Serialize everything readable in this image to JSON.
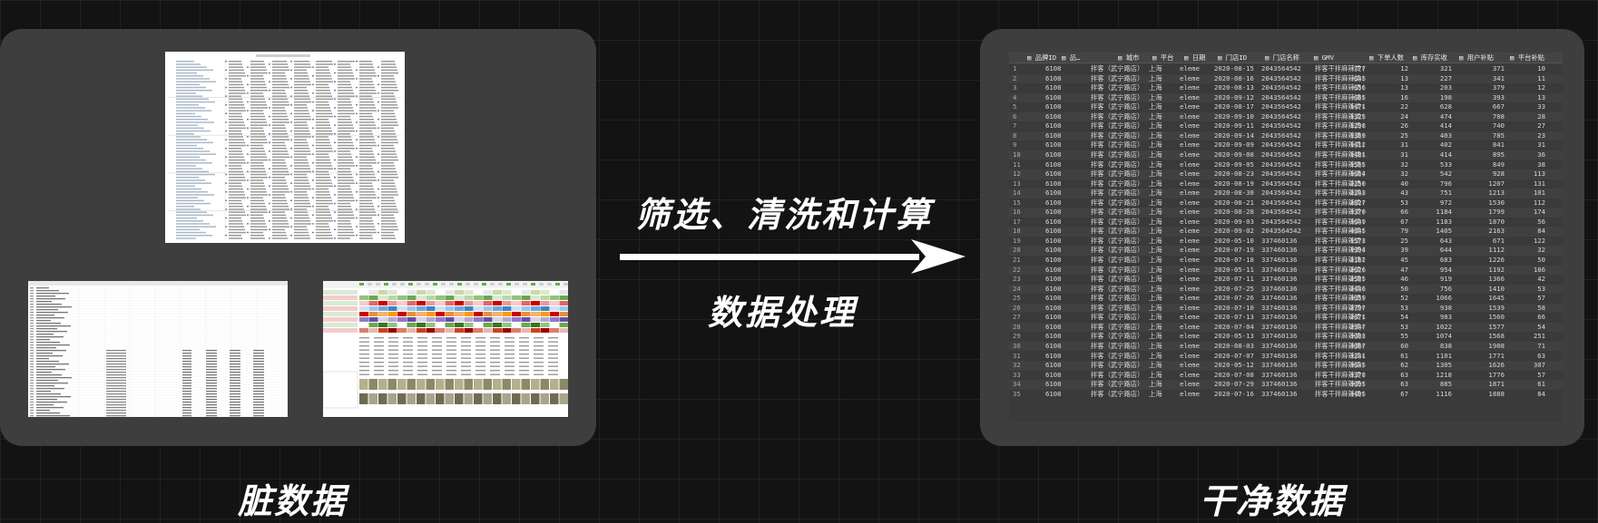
{
  "labels": {
    "dirty": "脏数据",
    "clean": "干净数据",
    "arrow_top": "筛选、清洗和计算",
    "arrow_bottom": "数据处理"
  },
  "clean_table": {
    "headers": [
      "品牌ID",
      "品…",
      "城市",
      "平台",
      "日期",
      "门店ID",
      "门店名称",
      "GMV",
      "下单人数",
      "库存实收",
      "用户补贴",
      "平台补贴"
    ],
    "rows": [
      [
        "1",
        "6108",
        "拌客（武宁路店）",
        "上海",
        "eleme",
        "2020-08-15",
        "2043564542",
        "拌客干拌麻辣烫(",
        "777",
        "12",
        "321",
        "371",
        "10"
      ],
      [
        "2",
        "6108",
        "拌客（武宁路店）",
        "上海",
        "eleme",
        "2020-08-16",
        "2043564542",
        "拌客干拌麻辣烫(",
        "645",
        "13",
        "227",
        "341",
        "11"
      ],
      [
        "3",
        "6108",
        "拌客（武宁路店）",
        "上海",
        "eleme",
        "2020-08-13",
        "2043564542",
        "拌客干拌麻辣烫(",
        "656",
        "13",
        "203",
        "379",
        "12"
      ],
      [
        "4",
        "6108",
        "拌客（武宁路店）",
        "上海",
        "eleme",
        "2020-09-12",
        "2043564542",
        "拌客干拌麻辣烫(",
        "665",
        "16",
        "198",
        "393",
        "13"
      ],
      [
        "5",
        "6108",
        "拌客（武宁路店）",
        "上海",
        "eleme",
        "2020-08-17",
        "2043564542",
        "拌客干拌麻辣烫(",
        "1471",
        "22",
        "628",
        "667",
        "33"
      ],
      [
        "6",
        "6108",
        "拌客（武宁路店）",
        "上海",
        "eleme",
        "2020-09-10",
        "2043564542",
        "拌客干拌麻辣烫(",
        "1325",
        "24",
        "474",
        "708",
        "28"
      ],
      [
        "7",
        "6108",
        "拌客（武宁路店）",
        "上海",
        "eleme",
        "2020-09-11",
        "2043564542",
        "拌客干拌麻辣烫(",
        "1298",
        "26",
        "414",
        "740",
        "27"
      ],
      [
        "8",
        "6108",
        "拌客（武宁路店）",
        "上海",
        "eleme",
        "2020-09-14",
        "2043564542",
        "拌客干拌麻辣烫(",
        "1369",
        "25",
        "403",
        "785",
        "23"
      ],
      [
        "9",
        "6108",
        "拌客（武宁路店）",
        "上海",
        "eleme",
        "2020-09-09",
        "2043564542",
        "拌客干拌麻辣烫(",
        "1412",
        "31",
        "402",
        "841",
        "31"
      ],
      [
        "10",
        "6108",
        "拌客（武宁路店）",
        "上海",
        "eleme",
        "2020-09-08",
        "2043564542",
        "拌客干拌麻辣烫(",
        "1481",
        "31",
        "414",
        "895",
        "36"
      ],
      [
        "11",
        "6108",
        "拌客（武宁路店）",
        "上海",
        "eleme",
        "2020-09-05",
        "2043564542",
        "拌客干拌麻辣烫(",
        "1565",
        "32",
        "533",
        "849",
        "38"
      ],
      [
        "12",
        "6108",
        "拌客（武宁路店）",
        "上海",
        "eleme",
        "2020-08-23",
        "2043564542",
        "拌客干拌麻辣烫(",
        "1664",
        "32",
        "542",
        "928",
        "113"
      ],
      [
        "13",
        "6108",
        "拌客（武宁路店）",
        "上海",
        "eleme",
        "2020-08-19",
        "2043564542",
        "拌客干拌麻辣烫(",
        "2250",
        "40",
        "796",
        "1207",
        "131"
      ],
      [
        "14",
        "6108",
        "拌客（武宁路店）",
        "上海",
        "eleme",
        "2020-08-30",
        "2043564542",
        "拌客干拌麻辣烫(",
        "2243",
        "43",
        "751",
        "1213",
        "101"
      ],
      [
        "15",
        "6108",
        "拌客（武宁路店）",
        "上海",
        "eleme",
        "2020-08-21",
        "2043564542",
        "拌客干拌麻辣烫(",
        "2827",
        "53",
        "972",
        "1530",
        "112"
      ],
      [
        "16",
        "6108",
        "拌客（武宁路店）",
        "上海",
        "eleme",
        "2020-08-28",
        "2043564542",
        "拌客干拌麻辣烫(",
        "3370",
        "66",
        "1184",
        "1799",
        "174"
      ],
      [
        "17",
        "6108",
        "拌客（武宁路店）",
        "上海",
        "eleme",
        "2020-09-03",
        "2043564542",
        "拌客干拌麻辣烫(",
        "3649",
        "67",
        "1183",
        "1870",
        "56"
      ],
      [
        "18",
        "6108",
        "拌客（武宁路店）",
        "上海",
        "eleme",
        "2020-09-02",
        "2043564542",
        "拌客干拌麻辣烫(",
        "4845",
        "79",
        "1405",
        "2163",
        "84"
      ],
      [
        "19",
        "6108",
        "拌客（武宁路店）",
        "上海",
        "eleme",
        "2020-05-10",
        "337460136",
        "拌客干拌麻辣烫(",
        "1573",
        "25",
        "643",
        "671",
        "122"
      ],
      [
        "20",
        "6108",
        "拌客（武宁路店）",
        "上海",
        "eleme",
        "2020-07-19",
        "337460136",
        "拌客干拌麻辣烫(",
        "1994",
        "39",
        "644",
        "1112",
        "32"
      ],
      [
        "21",
        "6108",
        "拌客（武宁路店）",
        "上海",
        "eleme",
        "2020-07-18",
        "337460136",
        "拌客干拌麻辣烫(",
        "2162",
        "45",
        "683",
        "1226",
        "50"
      ],
      [
        "22",
        "6108",
        "拌客（武宁路店）",
        "上海",
        "eleme",
        "2020-05-11",
        "337460136",
        "拌客干拌麻辣烫(",
        "2626",
        "47",
        "954",
        "1192",
        "186"
      ],
      [
        "23",
        "6108",
        "拌客（武宁路店）",
        "上海",
        "eleme",
        "2020-07-11",
        "337460136",
        "拌客干拌麻辣烫(",
        "2585",
        "46",
        "919",
        "1366",
        "42"
      ],
      [
        "24",
        "6108",
        "拌客（武宁路店）",
        "上海",
        "eleme",
        "2020-07-25",
        "337460136",
        "拌客干拌麻辣烫(",
        "2446",
        "50",
        "756",
        "1410",
        "53"
      ],
      [
        "25",
        "6108",
        "拌客（武宁路店）",
        "上海",
        "eleme",
        "2020-07-26",
        "337460136",
        "拌客干拌麻辣烫(",
        "3059",
        "52",
        "1066",
        "1645",
        "57"
      ],
      [
        "26",
        "6108",
        "拌客（武宁路店）",
        "上海",
        "eleme",
        "2020-07-10",
        "337460136",
        "拌客干拌麻辣烫(",
        "2797",
        "53",
        "938",
        "1539",
        "58"
      ],
      [
        "27",
        "6108",
        "拌客（武宁路店）",
        "上海",
        "eleme",
        "2020-07-13",
        "337460136",
        "拌客干拌麻辣烫(",
        "2871",
        "54",
        "983",
        "1560",
        "66"
      ],
      [
        "28",
        "6108",
        "拌客（武宁路店）",
        "上海",
        "eleme",
        "2020-07-04",
        "337460136",
        "拌客干拌麻辣烫(",
        "2947",
        "53",
        "1022",
        "1577",
        "54"
      ],
      [
        "29",
        "6108",
        "拌客（武宁路店）",
        "上海",
        "eleme",
        "2020-05-13",
        "337460136",
        "拌客干拌麻辣烫(",
        "3003",
        "55",
        "1074",
        "1568",
        "251"
      ],
      [
        "30",
        "6108",
        "拌客（武宁路店）",
        "上海",
        "eleme",
        "2020-08-03",
        "337460136",
        "拌客干拌麻辣烫(",
        "3067",
        "60",
        "838",
        "1908",
        "71"
      ],
      [
        "31",
        "6108",
        "拌客（武宁路店）",
        "上海",
        "eleme",
        "2020-07-07",
        "337460136",
        "拌客干拌麻辣烫(",
        "3241",
        "61",
        "1101",
        "1771",
        "63"
      ],
      [
        "32",
        "6108",
        "拌客（武宁路店）",
        "上海",
        "eleme",
        "2020-05-12",
        "337460136",
        "拌客干拌麻辣烫(",
        "3645",
        "62",
        "1305",
        "1626",
        "307"
      ],
      [
        "33",
        "6108",
        "拌客（武宁路店）",
        "上海",
        "eleme",
        "2020-07-08",
        "337460136",
        "拌客干拌麻辣烫(",
        "3378",
        "63",
        "1218",
        "1776",
        "57"
      ],
      [
        "34",
        "6108",
        "拌客（武宁路店）",
        "上海",
        "eleme",
        "2020-07-29",
        "337460136",
        "拌客干拌麻辣烫(",
        "3095",
        "63",
        "885",
        "1871",
        "61"
      ],
      [
        "35",
        "6108",
        "拌客（武宁路店）",
        "上海",
        "eleme",
        "2020-07-16",
        "337460136",
        "拌客干拌麻辣烫(",
        "3405",
        "67",
        "1116",
        "1888",
        "84"
      ]
    ]
  }
}
